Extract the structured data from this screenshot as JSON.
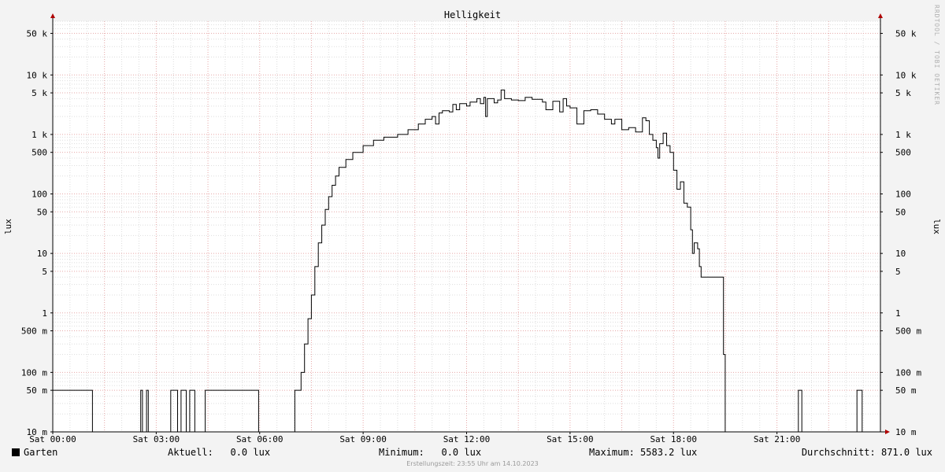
{
  "chart_data": {
    "type": "line",
    "title": "Helligkeit",
    "ylabel": "lux",
    "y_scale": "log",
    "ylim": [
      0.01,
      80000
    ],
    "xlim_hours": [
      0,
      24
    ],
    "x_ticks": [
      {
        "label": "Sat 00:00",
        "hour": 0
      },
      {
        "label": "Sat 03:00",
        "hour": 3
      },
      {
        "label": "Sat 06:00",
        "hour": 6
      },
      {
        "label": "Sat 09:00",
        "hour": 9
      },
      {
        "label": "Sat 12:00",
        "hour": 12
      },
      {
        "label": "Sat 15:00",
        "hour": 15
      },
      {
        "label": "Sat 18:00",
        "hour": 18
      },
      {
        "label": "Sat 21:00",
        "hour": 21
      }
    ],
    "y_ticks": [
      {
        "label": "10 m",
        "value": 0.01
      },
      {
        "label": "50 m",
        "value": 0.05
      },
      {
        "label": "100 m",
        "value": 0.1
      },
      {
        "label": "500 m",
        "value": 0.5
      },
      {
        "label": "1",
        "value": 1
      },
      {
        "label": "5",
        "value": 5
      },
      {
        "label": "10",
        "value": 10
      },
      {
        "label": "50",
        "value": 50
      },
      {
        "label": "100",
        "value": 100
      },
      {
        "label": "500",
        "value": 500
      },
      {
        "label": "1 k",
        "value": 1000
      },
      {
        "label": "5 k",
        "value": 5000
      },
      {
        "label": "10 k",
        "value": 10000
      },
      {
        "label": "50 k",
        "value": 50000
      }
    ],
    "grid": true,
    "legend_position": "bottom-left",
    "series": [
      {
        "name": "Garten",
        "color": "#000000",
        "points": [
          [
            0.0,
            0.05
          ],
          [
            1.1,
            0.05
          ],
          [
            1.15,
            0.01
          ],
          [
            2.5,
            0.01
          ],
          [
            2.55,
            0.05
          ],
          [
            2.6,
            0.01
          ],
          [
            2.7,
            0.01
          ],
          [
            2.72,
            0.05
          ],
          [
            2.77,
            0.01
          ],
          [
            3.4,
            0.01
          ],
          [
            3.42,
            0.05
          ],
          [
            3.6,
            0.05
          ],
          [
            3.62,
            0.01
          ],
          [
            3.7,
            0.01
          ],
          [
            3.72,
            0.05
          ],
          [
            3.85,
            0.05
          ],
          [
            3.87,
            0.01
          ],
          [
            3.95,
            0.01
          ],
          [
            3.97,
            0.05
          ],
          [
            4.1,
            0.05
          ],
          [
            4.12,
            0.01
          ],
          [
            4.4,
            0.01
          ],
          [
            4.42,
            0.05
          ],
          [
            5.95,
            0.05
          ],
          [
            5.97,
            0.01
          ],
          [
            7.0,
            0.01
          ],
          [
            7.02,
            0.05
          ],
          [
            7.15,
            0.05
          ],
          [
            7.2,
            0.1
          ],
          [
            7.3,
            0.3
          ],
          [
            7.4,
            0.8
          ],
          [
            7.5,
            2
          ],
          [
            7.6,
            6
          ],
          [
            7.7,
            15
          ],
          [
            7.8,
            30
          ],
          [
            7.9,
            55
          ],
          [
            8.0,
            90
          ],
          [
            8.1,
            140
          ],
          [
            8.2,
            200
          ],
          [
            8.3,
            280
          ],
          [
            8.5,
            380
          ],
          [
            8.7,
            500
          ],
          [
            9.0,
            650
          ],
          [
            9.3,
            800
          ],
          [
            9.6,
            900
          ],
          [
            10.0,
            1000
          ],
          [
            10.3,
            1200
          ],
          [
            10.6,
            1500
          ],
          [
            10.8,
            1800
          ],
          [
            11.0,
            2000
          ],
          [
            11.1,
            1500
          ],
          [
            11.2,
            2300
          ],
          [
            11.3,
            2500
          ],
          [
            11.5,
            2400
          ],
          [
            11.6,
            3200
          ],
          [
            11.7,
            2600
          ],
          [
            11.8,
            3300
          ],
          [
            12.0,
            3000
          ],
          [
            12.1,
            3500
          ],
          [
            12.3,
            4000
          ],
          [
            12.4,
            3300
          ],
          [
            12.5,
            4200
          ],
          [
            12.55,
            2000
          ],
          [
            12.6,
            4000
          ],
          [
            12.8,
            3400
          ],
          [
            12.9,
            3800
          ],
          [
            13.0,
            5583.2
          ],
          [
            13.1,
            4000
          ],
          [
            13.3,
            3800
          ],
          [
            13.5,
            3700
          ],
          [
            13.7,
            4200
          ],
          [
            13.9,
            3900
          ],
          [
            14.2,
            3500
          ],
          [
            14.3,
            2600
          ],
          [
            14.5,
            3600
          ],
          [
            14.7,
            2400
          ],
          [
            14.8,
            4000
          ],
          [
            14.9,
            3000
          ],
          [
            15.0,
            2800
          ],
          [
            15.2,
            1500
          ],
          [
            15.4,
            2500
          ],
          [
            15.6,
            2600
          ],
          [
            15.8,
            2200
          ],
          [
            16.0,
            1800
          ],
          [
            16.2,
            1500
          ],
          [
            16.3,
            1800
          ],
          [
            16.5,
            1200
          ],
          [
            16.7,
            1300
          ],
          [
            16.9,
            1100
          ],
          [
            17.1,
            1900
          ],
          [
            17.2,
            1700
          ],
          [
            17.3,
            1000
          ],
          [
            17.4,
            800
          ],
          [
            17.5,
            600
          ],
          [
            17.55,
            400
          ],
          [
            17.6,
            700
          ],
          [
            17.7,
            1050
          ],
          [
            17.8,
            650
          ],
          [
            17.9,
            500
          ],
          [
            18.0,
            250
          ],
          [
            18.1,
            120
          ],
          [
            18.2,
            160
          ],
          [
            18.3,
            70
          ],
          [
            18.4,
            60
          ],
          [
            18.5,
            25
          ],
          [
            18.55,
            10
          ],
          [
            18.6,
            15
          ],
          [
            18.7,
            12
          ],
          [
            18.75,
            6
          ],
          [
            18.8,
            4
          ],
          [
            19.4,
            4
          ],
          [
            19.45,
            0.2
          ],
          [
            19.5,
            0.01
          ],
          [
            21.6,
            0.01
          ],
          [
            21.62,
            0.05
          ],
          [
            21.7,
            0.05
          ],
          [
            21.72,
            0.01
          ],
          [
            23.3,
            0.01
          ],
          [
            23.32,
            0.05
          ],
          [
            23.45,
            0.05
          ],
          [
            23.47,
            0.01
          ],
          [
            24.0,
            0.01
          ]
        ]
      }
    ]
  },
  "legend": {
    "series_name": "Garten",
    "aktuell": "Aktuell:   0.0 lux",
    "minimum": "Minimum:   0.0 lux",
    "maximum": "Maximum: 5583.2 lux",
    "durchschnitt": "Durchschnitt: 871.0 lux"
  },
  "footer": "Erstellungszeit: 23:55 Uhr am 14.10.2023",
  "watermark": "RRDTOOL / TOBI OETIKER",
  "colors": {
    "background": "#f3f3f3",
    "plot_background": "#ffffff",
    "major_grid": "#e6a8a8",
    "minor_grid": "#dddddd",
    "axis_arrow": "#b00000",
    "line": "#000000"
  }
}
